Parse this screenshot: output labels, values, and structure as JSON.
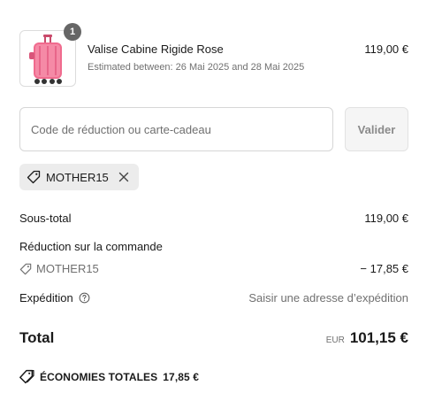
{
  "product": {
    "quantity": "1",
    "name": "Valise Cabine Rigide Rose",
    "estimate": "Estimated between: 26 Mai 2025 and 28 Mai 2025",
    "price": "119,00 €",
    "image_icon": "pink-suitcase-icon",
    "image_color": "#f06b8e"
  },
  "discount": {
    "placeholder": "Code de réduction ou carte-cadeau",
    "value": "",
    "apply_label": "Valider"
  },
  "applied_code": {
    "code": "MOTHER15",
    "tag_icon": "tag-icon",
    "remove_icon": "close-icon"
  },
  "summary": {
    "subtotal_label": "Sous-total",
    "subtotal_value": "119,00 €",
    "order_discount_label": "Réduction sur la commande",
    "order_discount_code": "MOTHER15",
    "order_discount_value": "− 17,85 €",
    "shipping_label": "Expédition",
    "shipping_help_icon": "help-circle-icon",
    "shipping_value": "Saisir une adresse d’expédition"
  },
  "total": {
    "label": "Total",
    "currency": "EUR",
    "value": "101,15 €"
  },
  "savings": {
    "icon": "tag-icon",
    "label": "ÉCONOMIES TOTALES",
    "value": "17,85 €"
  },
  "colors": {
    "text": "#1a1a1a",
    "muted": "#707070",
    "badge": "#666666",
    "chip_bg": "#ececec"
  }
}
